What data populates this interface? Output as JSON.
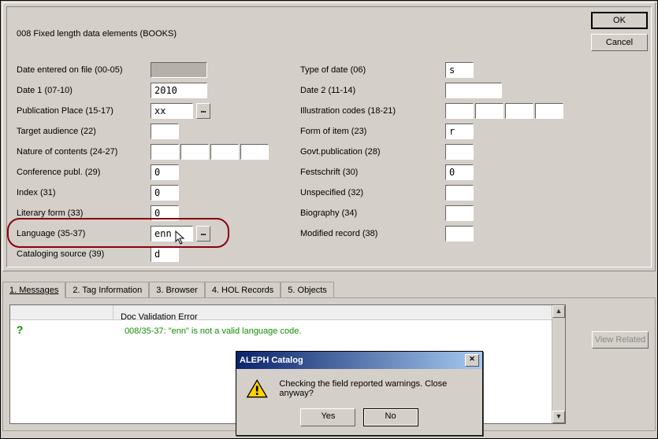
{
  "header": {
    "title": "008 Fixed length data elements (BOOKS)"
  },
  "buttons": {
    "ok": "OK",
    "cancel": "Cancel",
    "view_related": "View Related"
  },
  "left": {
    "date_entered": {
      "label": "Date entered on file (00-05)",
      "value": ""
    },
    "date1": {
      "label": "Date 1 (07-10)",
      "value": "2010"
    },
    "pub_place": {
      "label": "Publication Place (15-17)",
      "value": "xx"
    },
    "target_aud": {
      "label": "Target audience (22)",
      "value": ""
    },
    "nature": {
      "label": "Nature of contents (24-27)",
      "values": [
        "",
        "",
        "",
        ""
      ]
    },
    "conf_publ": {
      "label": "Conference publ. (29)",
      "value": "0"
    },
    "index": {
      "label": "Index (31)",
      "value": "0"
    },
    "lit_form": {
      "label": "Literary form (33)",
      "value": "0"
    },
    "language": {
      "label": "Language (35-37)",
      "value": "enn"
    },
    "cat_source": {
      "label": "Cataloging source (39)",
      "value": "d"
    }
  },
  "right": {
    "type_date": {
      "label": "Type of date (06)",
      "value": "s"
    },
    "date2": {
      "label": "Date 2 (11-14)",
      "value": ""
    },
    "illus": {
      "label": "Illustration codes (18-21)",
      "values": [
        "",
        "",
        "",
        ""
      ]
    },
    "form_item": {
      "label": "Form of item (23)",
      "value": "r"
    },
    "govt_pub": {
      "label": "Govt.publication (28)",
      "value": ""
    },
    "festschrift": {
      "label": "Festschrift (30)",
      "value": "0"
    },
    "unspecified": {
      "label": "Unspecified (32)",
      "value": ""
    },
    "biography": {
      "label": "Biography (34)",
      "value": ""
    },
    "mod_record": {
      "label": "Modified record (38)",
      "value": ""
    }
  },
  "tabs": [
    "1. Messages",
    "2. Tag Information",
    "3. Browser",
    "4. HOL Records",
    "5. Objects"
  ],
  "messages": {
    "header": "Doc Validation Error",
    "line": "008/35-37: \"enn\" is not a valid language code."
  },
  "dialog": {
    "title": "ALEPH Catalog",
    "text": "Checking the field reported warnings. Close anyway?",
    "yes": "Yes",
    "no": "No"
  },
  "picker_glyph": "…"
}
